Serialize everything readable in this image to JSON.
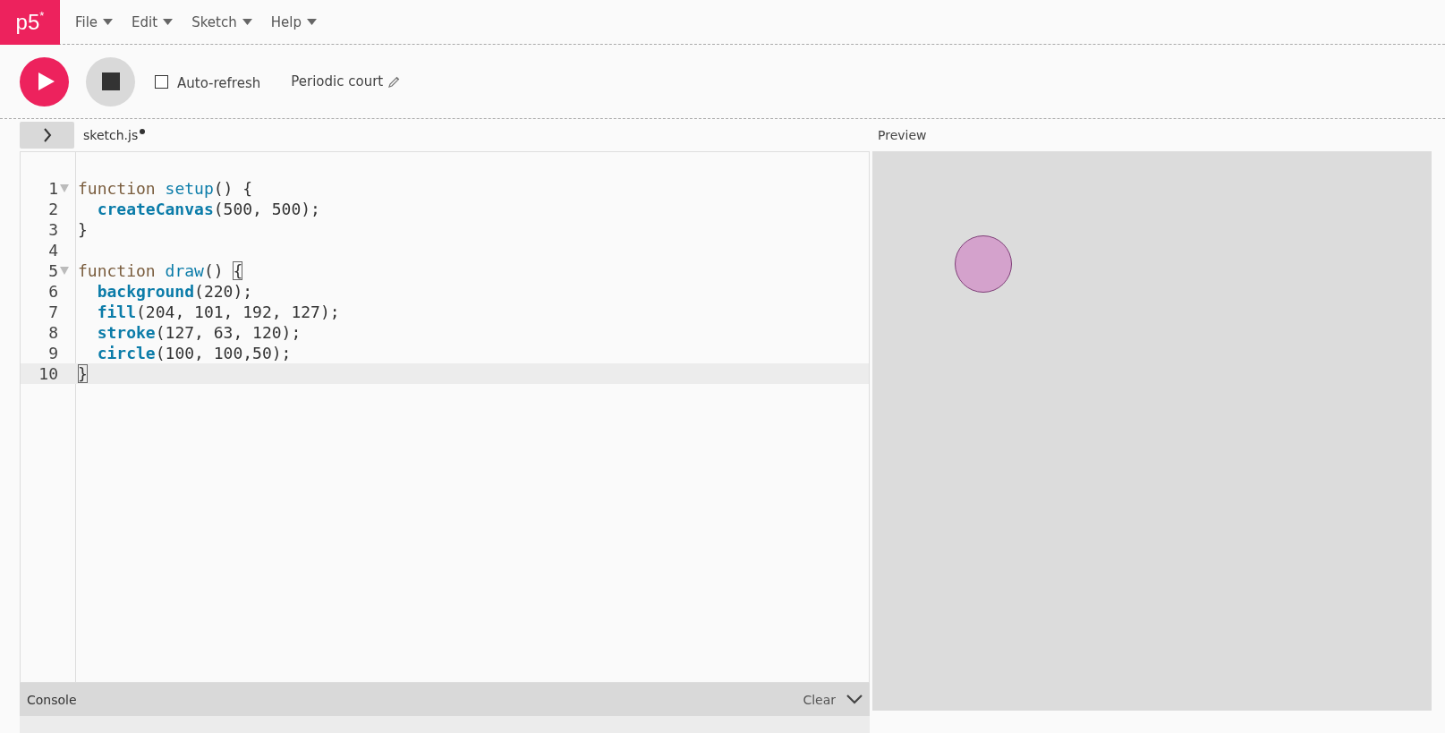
{
  "logo": {
    "text": "p5",
    "mark": "*"
  },
  "menu": [
    {
      "label": "File"
    },
    {
      "label": "Edit"
    },
    {
      "label": "Sketch"
    },
    {
      "label": "Help"
    }
  ],
  "toolbar": {
    "auto_refresh": {
      "label": "Auto-refresh",
      "checked": false
    },
    "sketch_name": "Periodic court"
  },
  "editor": {
    "file_tab": {
      "name": "sketch.js",
      "unsaved": true
    },
    "lines": [
      {
        "number": "1",
        "foldable": true,
        "selected": false,
        "indented": false,
        "tokens": [
          {
            "text": "function ",
            "kind": "keyword"
          },
          {
            "text": "setup",
            "kind": "def"
          },
          {
            "text": "() {",
            "kind": "plain"
          }
        ]
      },
      {
        "number": "2",
        "foldable": false,
        "selected": false,
        "indented": true,
        "tokens": [
          {
            "text": "createCanvas",
            "kind": "builtin"
          },
          {
            "text": "(500, 500);",
            "kind": "plain"
          }
        ]
      },
      {
        "number": "3",
        "foldable": false,
        "selected": false,
        "indented": false,
        "tokens": [
          {
            "text": "}",
            "kind": "plain"
          }
        ]
      },
      {
        "number": "4",
        "foldable": false,
        "selected": false,
        "indented": false
      },
      {
        "number": "5",
        "foldable": true,
        "selected": false,
        "indented": false,
        "tokens": [
          {
            "text": "function ",
            "kind": "keyword"
          },
          {
            "text": "draw",
            "kind": "def"
          },
          {
            "text": "() ",
            "kind": "plain"
          },
          {
            "text": "{",
            "kind": "match"
          }
        ]
      },
      {
        "number": "6",
        "foldable": false,
        "selected": false,
        "indented": true,
        "tokens": [
          {
            "text": "background",
            "kind": "builtin"
          },
          {
            "text": "(220);",
            "kind": "plain"
          }
        ]
      },
      {
        "number": "7",
        "foldable": false,
        "selected": false,
        "indented": true,
        "tokens": [
          {
            "text": "fill",
            "kind": "builtin"
          },
          {
            "text": "(204, 101, 192, 127);",
            "kind": "plain"
          }
        ]
      },
      {
        "number": "8",
        "foldable": false,
        "selected": false,
        "indented": true,
        "tokens": [
          {
            "text": "stroke",
            "kind": "builtin"
          },
          {
            "text": "(127, 63, 120);",
            "kind": "plain"
          }
        ]
      },
      {
        "number": "9",
        "foldable": false,
        "selected": false,
        "indented": true,
        "tokens": [
          {
            "text": "circle",
            "kind": "builtin"
          },
          {
            "text": "(100, 100,50);",
            "kind": "plain"
          }
        ]
      },
      {
        "number": "10",
        "foldable": false,
        "selected": true,
        "indented": false,
        "tokens": [
          {
            "text": "}",
            "kind": "match"
          }
        ]
      }
    ]
  },
  "console": {
    "title": "Console",
    "clear": "Clear"
  },
  "preview": {
    "title": "Preview"
  }
}
